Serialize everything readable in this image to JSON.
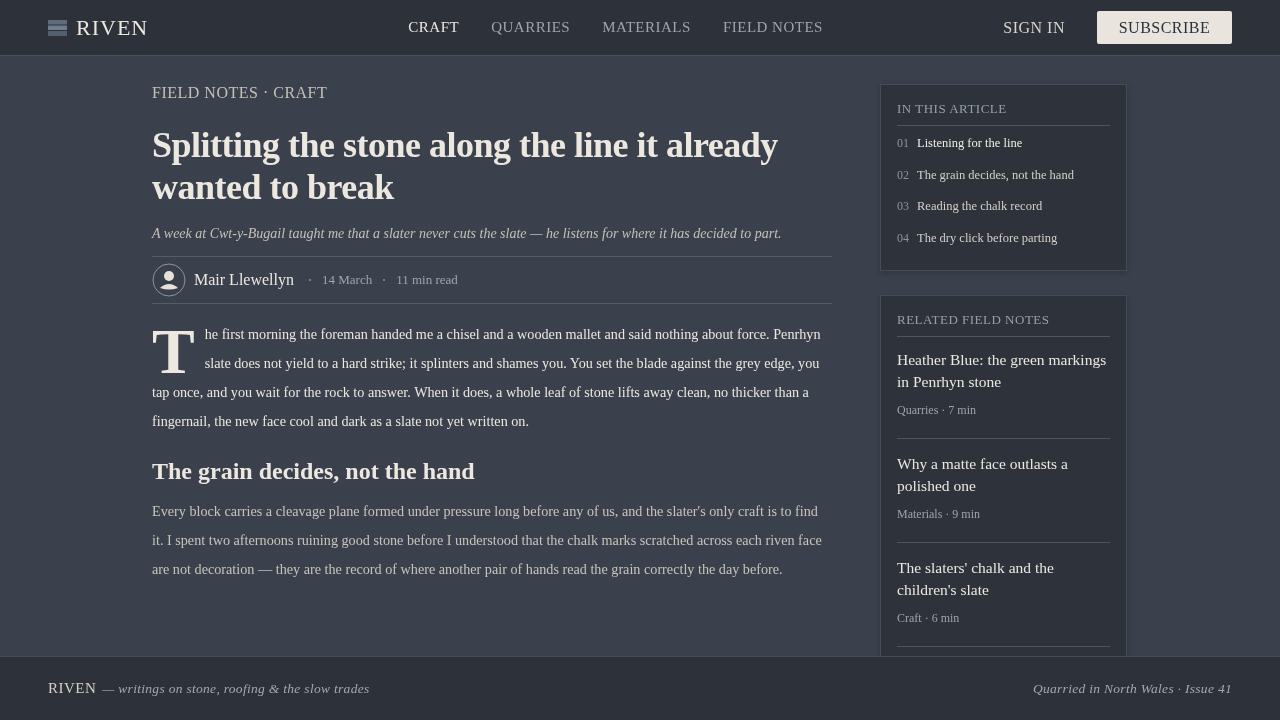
{
  "brand": {
    "name": "RIVEN"
  },
  "nav": [
    {
      "label": "CRAFT",
      "selected": true
    },
    {
      "label": "QUARRIES",
      "selected": false
    },
    {
      "label": "MATERIALS",
      "selected": false
    },
    {
      "label": "FIELD NOTES",
      "selected": false
    }
  ],
  "actions": {
    "sign_in": "SIGN IN",
    "subscribe": "SUBSCRIBE"
  },
  "article": {
    "breadcrumb": "FIELD NOTES · CRAFT",
    "title": "Splitting the stone along the line it already wanted to break",
    "standfirst": "A week at Cwt-y-Bugail taught me that a slater never cuts the slate — he listens for where it has decided to part.",
    "author": "Mair Llewellyn",
    "date": "14 March",
    "read_time": "11 min read",
    "drop_cap": "T",
    "lead": "he first morning the foreman handed me a chisel and a wooden mallet and said nothing about force. Penrhyn slate does not yield to a hard strike; it splinters and shames you. You set the blade against the grey edge, you tap once, and you wait for the rock to answer. When it does, a whole leaf of stone lifts away clean, no thicker than a fingernail, the new face cool and dark as a slate not yet written on.",
    "heading": "The grain decides, not the hand",
    "body": "Every block carries a cleavage plane formed under pressure long before any of us, and the slater's only craft is to find it. I spent two afternoons ruining good stone before I understood that the chalk marks scratched across each riven face are not decoration — they are the record of where another pair of hands read the grain correctly the day before."
  },
  "toc": {
    "title": "IN THIS ARTICLE",
    "items": [
      {
        "number": "01",
        "label": "Listening for the line",
        "selected": true
      },
      {
        "number": "02",
        "label": "The grain decides, not the hand",
        "selected": false
      },
      {
        "number": "03",
        "label": "Reading the chalk record",
        "selected": false
      },
      {
        "number": "04",
        "label": "The dry click before parting",
        "selected": false
      }
    ]
  },
  "related": {
    "title": "RELATED FIELD NOTES",
    "items": [
      {
        "title": "Heather Blue: the green markings in Penrhyn stone",
        "meta": "Quarries · 7 min"
      },
      {
        "title": "Why a matte face outlasts a polished one",
        "meta": "Materials · 9 min"
      },
      {
        "title": "The slaters' chalk and the children's slate",
        "meta": "Craft · 6 min"
      }
    ]
  },
  "footer": {
    "brand": "RIVEN",
    "tagline": "— writings on stone, roofing & the slow trades",
    "note": "Quarried in North Wales · Issue 41"
  }
}
